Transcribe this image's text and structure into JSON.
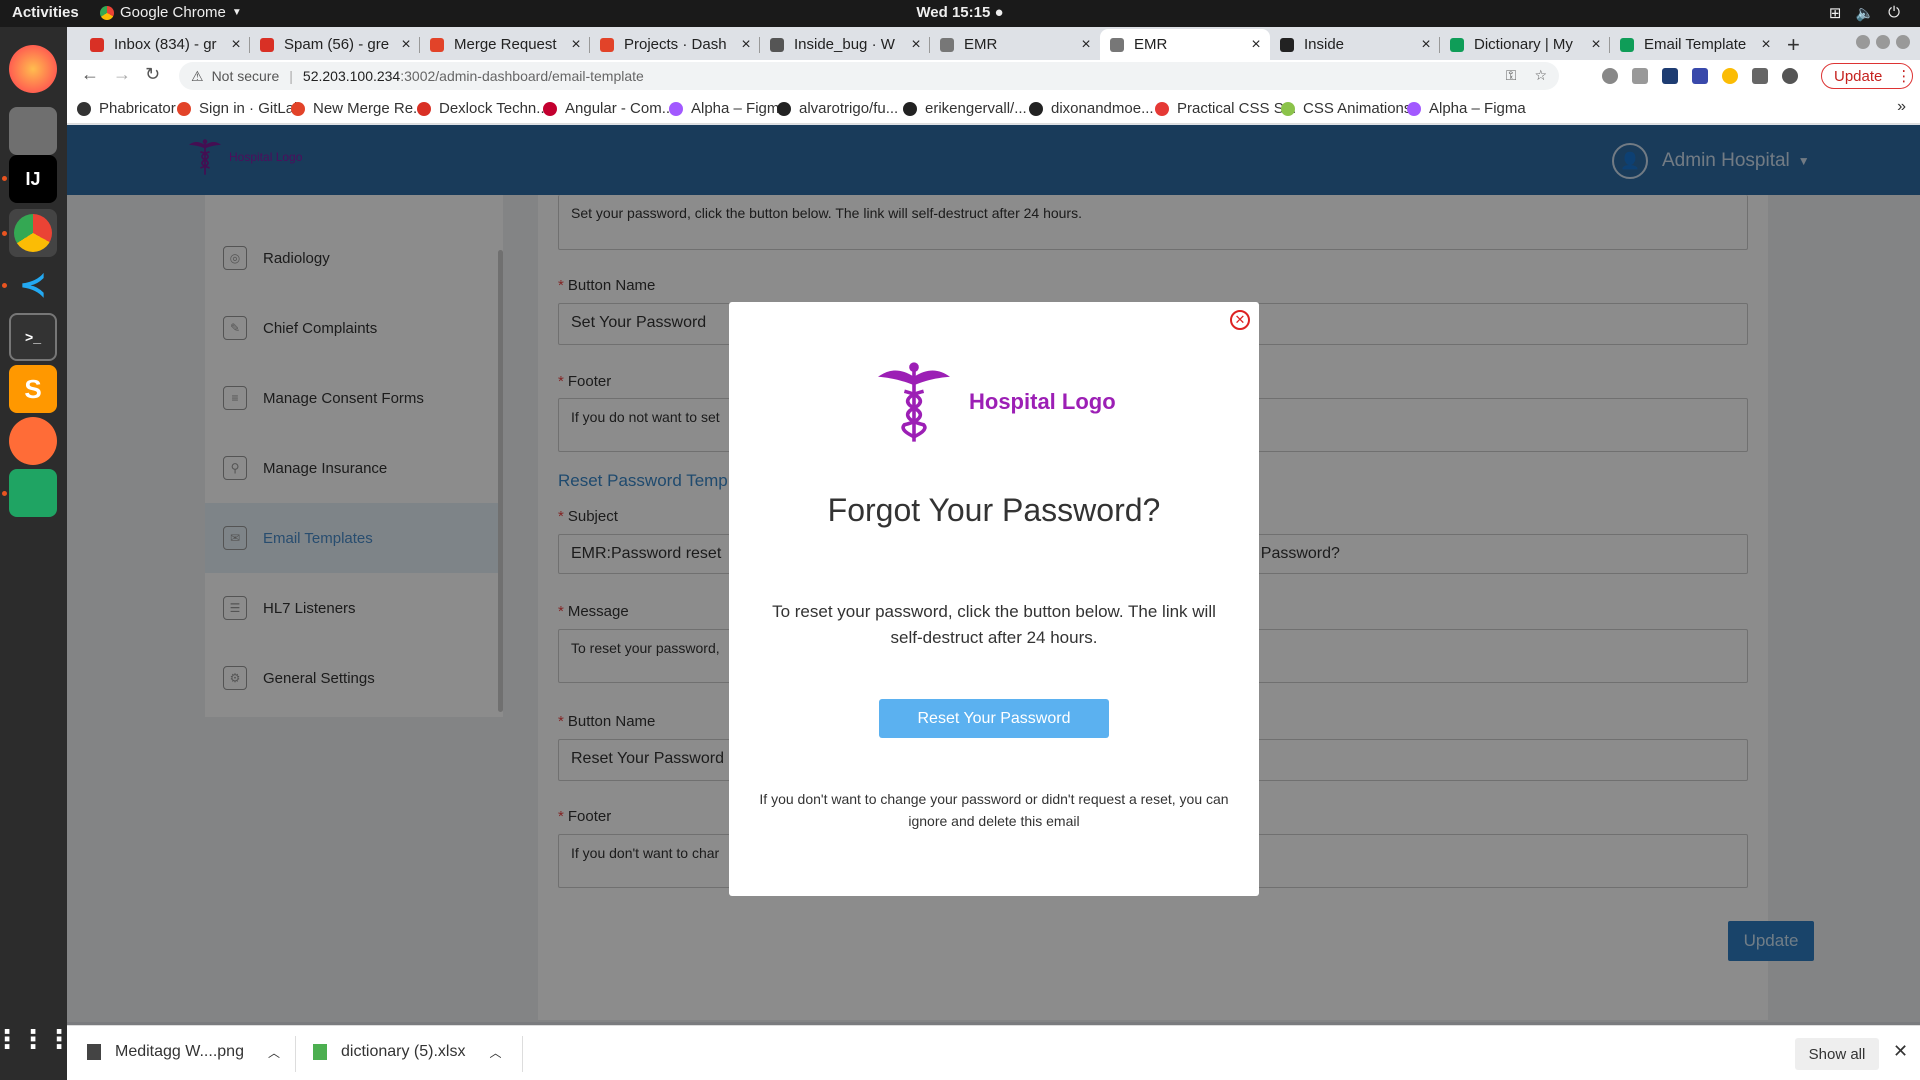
{
  "os": {
    "activities": "Activities",
    "app_name": "Google Chrome",
    "clock": "Wed 15:15"
  },
  "tabs": [
    {
      "label": "Inbox (834) - gr",
      "color": "#d93025"
    },
    {
      "label": "Spam (56) - gre",
      "color": "#d93025"
    },
    {
      "label": "Merge Request",
      "color": "#e24329"
    },
    {
      "label": "Projects · Dash",
      "color": "#e24329"
    },
    {
      "label": "Inside_bug · W",
      "color": "#555555"
    },
    {
      "label": "EMR",
      "color": "#777777"
    },
    {
      "label": "EMR",
      "color": "#777777"
    },
    {
      "label": "Inside",
      "color": "#222222"
    },
    {
      "label": "Dictionary | My",
      "color": "#0f9d58"
    },
    {
      "label": "Email Template",
      "color": "#0f9d58"
    }
  ],
  "browser": {
    "not_secure": "Not secure",
    "url_host": "52.203.100.234",
    "url_path": ":3002/admin-dashboard/email-template",
    "update_label": "Update"
  },
  "bookmarks": [
    {
      "label": "Phabricator",
      "color": "#333333"
    },
    {
      "label": "Sign in · GitLab",
      "color": "#e24329"
    },
    {
      "label": "New Merge Re...",
      "color": "#e24329"
    },
    {
      "label": "Dexlock Techn...",
      "color": "#d93025"
    },
    {
      "label": "Angular - Com...",
      "color": "#c3002f"
    },
    {
      "label": "Alpha – Figma",
      "color": "#a259ff"
    },
    {
      "label": "alvarotrigo/fu...",
      "color": "#222222"
    },
    {
      "label": "erikengervall/...",
      "color": "#222222"
    },
    {
      "label": "dixonandmoe...",
      "color": "#222222"
    },
    {
      "label": "Practical CSS S...",
      "color": "#e53935"
    },
    {
      "label": "CSS Animations",
      "color": "#8bc34a"
    },
    {
      "label": "Alpha – Figma",
      "color": "#a259ff"
    }
  ],
  "header": {
    "logo_text": "Hospital Logo",
    "user_name": "Admin Hospital"
  },
  "sidebar": {
    "items": [
      {
        "label": "Radiology"
      },
      {
        "label": "Chief Complaints"
      },
      {
        "label": "Manage Consent Forms"
      },
      {
        "label": "Manage Insurance"
      },
      {
        "label": "Email Templates"
      },
      {
        "label": "HL7 Listeners"
      },
      {
        "label": "General Settings"
      }
    ]
  },
  "form": {
    "prev_message_value": "Set your password, click the button below. The link will self-destruct after 24 hours.",
    "button_name_label": "Button Name",
    "set_button_value": "Set Your Password",
    "footer_label": "Footer",
    "set_footer_value": "If you do not want to set",
    "reset_section_title": "Reset Password Temp",
    "subject_label": "Subject",
    "subject_value": "EMR:Password reset",
    "subject_value_right": "r Password?",
    "message_label": "Message",
    "reset_message_value": "To reset your password,",
    "reset_button_value": "Reset Your Password",
    "reset_footer_value": "If you don't want to char",
    "update_button": "Update"
  },
  "modal": {
    "logo_text": "Hospital Logo",
    "title": "Forgot Your Password?",
    "message": "To reset your password, click the button below. The link will self-destruct after 24 hours.",
    "button": "Reset Your Password",
    "footer": "If you don't want to change your password or didn't request a reset, you can ignore and delete this email"
  },
  "downloads": {
    "file1": "Meditagg W....png",
    "file2": "dictionary (5).xlsx",
    "show_all": "Show all"
  }
}
